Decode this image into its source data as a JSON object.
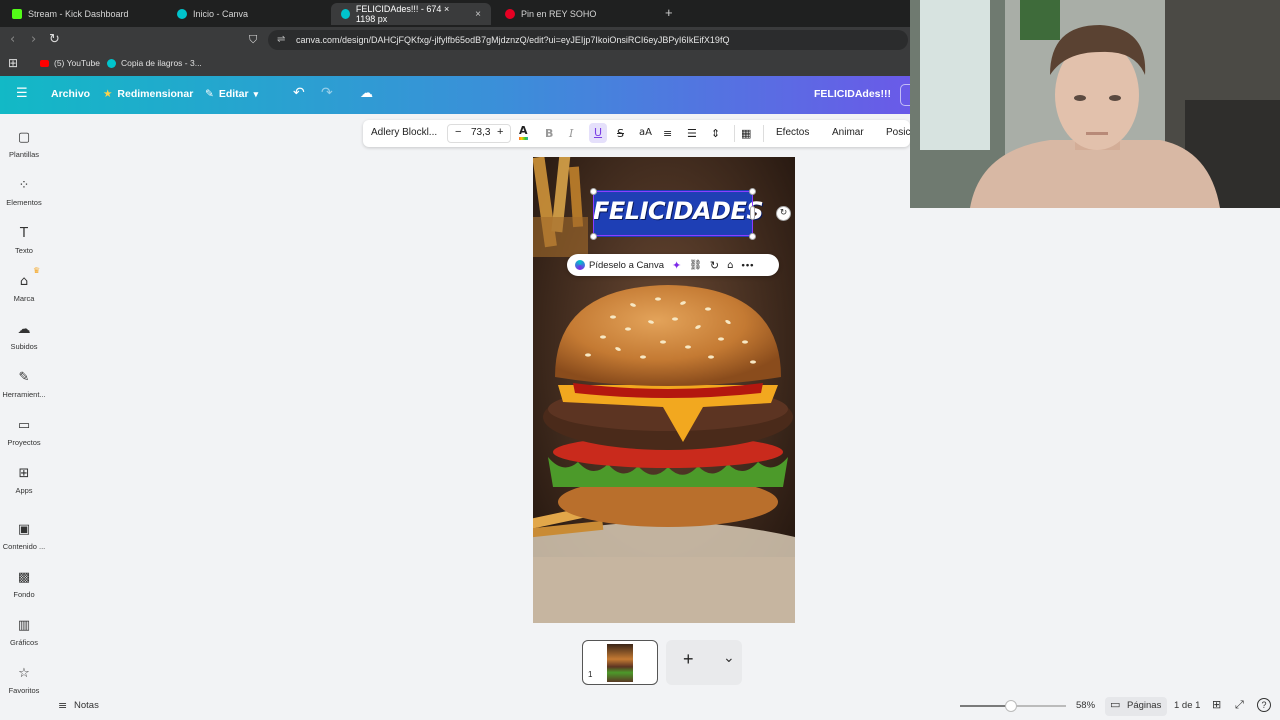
{
  "browser": {
    "tabs": [
      {
        "title": "Stream - Kick Dashboard",
        "color": "#53fc18"
      },
      {
        "title": "Inicio - Canva",
        "color": "#00c4cc"
      },
      {
        "title": "FELICIDAdes!!! - 674 × 1198 px",
        "color": "#00c4cc",
        "active": true
      },
      {
        "title": "Pin en REY SOHO",
        "color": "#e60023"
      }
    ],
    "new_tab": "+",
    "close": "×",
    "url": "canva.com/design/DAHCjFQKfxg/-jlfylfb65odB7gMjdznzQ/edit?ui=eyJEIjp7IkoiOnsiRCI6eyJBPyI6IkEifX19fQ",
    "bookmarks": [
      "(5) YouTube",
      "Copia de ilagros - 3..."
    ]
  },
  "canva_header": {
    "file": "Archivo",
    "resize": "Redimensionar",
    "edit": "Editar",
    "design_title": "FELICIDAdes!!!"
  },
  "sidebar": [
    {
      "label": "Plantillas",
      "icon": "templates-icon",
      "glyph": "▢"
    },
    {
      "label": "Elementos",
      "icon": "elements-icon",
      "glyph": "⁘"
    },
    {
      "label": "Texto",
      "icon": "text-icon",
      "glyph": "T"
    },
    {
      "label": "Marca",
      "icon": "brand-icon",
      "glyph": "⌂"
    },
    {
      "label": "Subidos",
      "icon": "uploads-icon",
      "glyph": "☁"
    },
    {
      "label": "Herramient...",
      "icon": "tools-icon",
      "glyph": "✎"
    },
    {
      "label": "Proyectos",
      "icon": "projects-icon",
      "glyph": "▭"
    },
    {
      "label": "Apps",
      "icon": "apps-icon",
      "glyph": "⊞"
    },
    {
      "label": "Contenido ...",
      "icon": "content-icon",
      "glyph": "▣"
    },
    {
      "label": "Fondo",
      "icon": "background-icon",
      "glyph": "▩"
    },
    {
      "label": "Gráficos",
      "icon": "charts-icon",
      "glyph": "▥"
    },
    {
      "label": "Favoritos",
      "icon": "favorites-icon",
      "glyph": "☆"
    }
  ],
  "toolbar": {
    "font": "Adlery Blockl...",
    "minus": "−",
    "size": "73,3",
    "plus": "+",
    "effects": "Efectos",
    "animate": "Animar",
    "position": "Posic"
  },
  "canvas": {
    "headline": "FELICIDADES"
  },
  "context_pill": {
    "ask_canva": "Pídeselo a Canva"
  },
  "pages": {
    "thumb_number": "1",
    "add": "+",
    "chevron": "⌄"
  },
  "bottom": {
    "notes": "Notas",
    "zoom": "58%",
    "zoom_fraction": 0.58,
    "pages": "Páginas",
    "page_count": "1 de 1",
    "help": "?"
  }
}
